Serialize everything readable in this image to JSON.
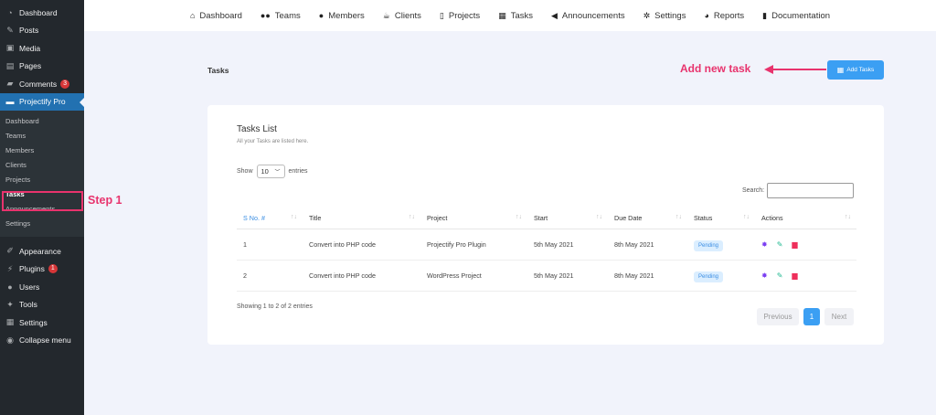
{
  "sidebar": {
    "items_top": [
      {
        "label": "Dashboard",
        "icon": "dashboard-icon"
      },
      {
        "label": "Posts",
        "icon": "pin-icon"
      },
      {
        "label": "Media",
        "icon": "media-icon"
      },
      {
        "label": "Pages",
        "icon": "pages-icon"
      },
      {
        "label": "Comments",
        "icon": "comments-icon",
        "badge": "3"
      },
      {
        "label": "Projectify Pro",
        "icon": "folder-icon",
        "active": true
      }
    ],
    "sub_items": [
      "Dashboard",
      "Teams",
      "Members",
      "Clients",
      "Projects",
      "Tasks",
      "Announcements",
      "Settings"
    ],
    "items_bottom": [
      {
        "label": "Appearance",
        "icon": "brush-icon"
      },
      {
        "label": "Plugins",
        "icon": "plugin-icon",
        "badge": "1"
      },
      {
        "label": "Users",
        "icon": "user-icon"
      },
      {
        "label": "Tools",
        "icon": "wrench-icon"
      },
      {
        "label": "Settings",
        "icon": "settings-icon"
      },
      {
        "label": "Collapse menu",
        "icon": "collapse-icon"
      }
    ]
  },
  "annotations": {
    "step1": "Step 1",
    "add_new": "Add new task"
  },
  "topnav": [
    "Dashboard",
    "Teams",
    "Members",
    "Clients",
    "Projects",
    "Tasks",
    "Announcements",
    "Settings",
    "Reports",
    "Documentation"
  ],
  "page": {
    "title": "Tasks",
    "add_button": "Add Tasks"
  },
  "card": {
    "title": "Tasks List",
    "subtitle": "All your Tasks are listed here.",
    "show_label": "Show",
    "entries_value": "10",
    "entries_label": "entries",
    "search_label": "Search:",
    "columns": [
      "S No. #",
      "Title",
      "Project",
      "Start",
      "Due Date",
      "Status",
      "Actions"
    ],
    "rows": [
      {
        "no": "1",
        "title": "Convert into PHP code",
        "project": "Projectify Pro Plugin",
        "start": "5th May 2021",
        "due": "8th May 2021",
        "status": "Pending"
      },
      {
        "no": "2",
        "title": "Convert into PHP code",
        "project": "WordPress Project",
        "start": "5th May 2021",
        "due": "8th May 2021",
        "status": "Pending"
      }
    ],
    "showing": "Showing 1 to 2 of 2 entries",
    "pager": {
      "prev": "Previous",
      "page": "1",
      "next": "Next"
    }
  }
}
